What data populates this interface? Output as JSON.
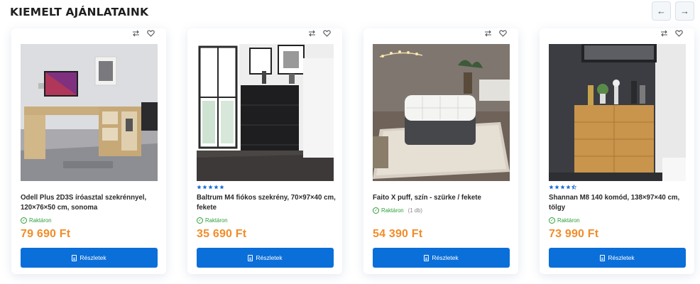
{
  "section": {
    "title": "KIEMELT AJÁNLATAINK",
    "prev_icon": "arrow-left-icon",
    "next_icon": "arrow-right-icon"
  },
  "colors": {
    "accent": "#0a6fd9",
    "price": "#f28c28",
    "stock": "#2e9e3a",
    "star": "#1b6fd6"
  },
  "products": [
    {
      "name": "Odell Plus 2D3S íróasztal szekrénnyel, 120×76×50 cm, sonoma",
      "stock": "Raktáron",
      "stock_qty": "",
      "price": "79 690 Ft",
      "button": "Részletek",
      "rating": null
    },
    {
      "name": "Baltrum M4 fiókos szekrény, 70×97×40 cm, fekete",
      "stock": "Raktáron",
      "stock_qty": "",
      "price": "35 690 Ft",
      "button": "Részletek",
      "rating": 5
    },
    {
      "name": "Faito X puff, szín - szürke / fekete",
      "stock": "Raktáron",
      "stock_qty": "(1 db)",
      "price": "54 390 Ft",
      "button": "Részletek",
      "rating": null
    },
    {
      "name": "Shannan M8 140 komód, 138×97×40 cm, tölgy",
      "stock": "Raktáron",
      "stock_qty": "",
      "price": "73 990 Ft",
      "button": "Részletek",
      "rating": 4.5
    }
  ]
}
